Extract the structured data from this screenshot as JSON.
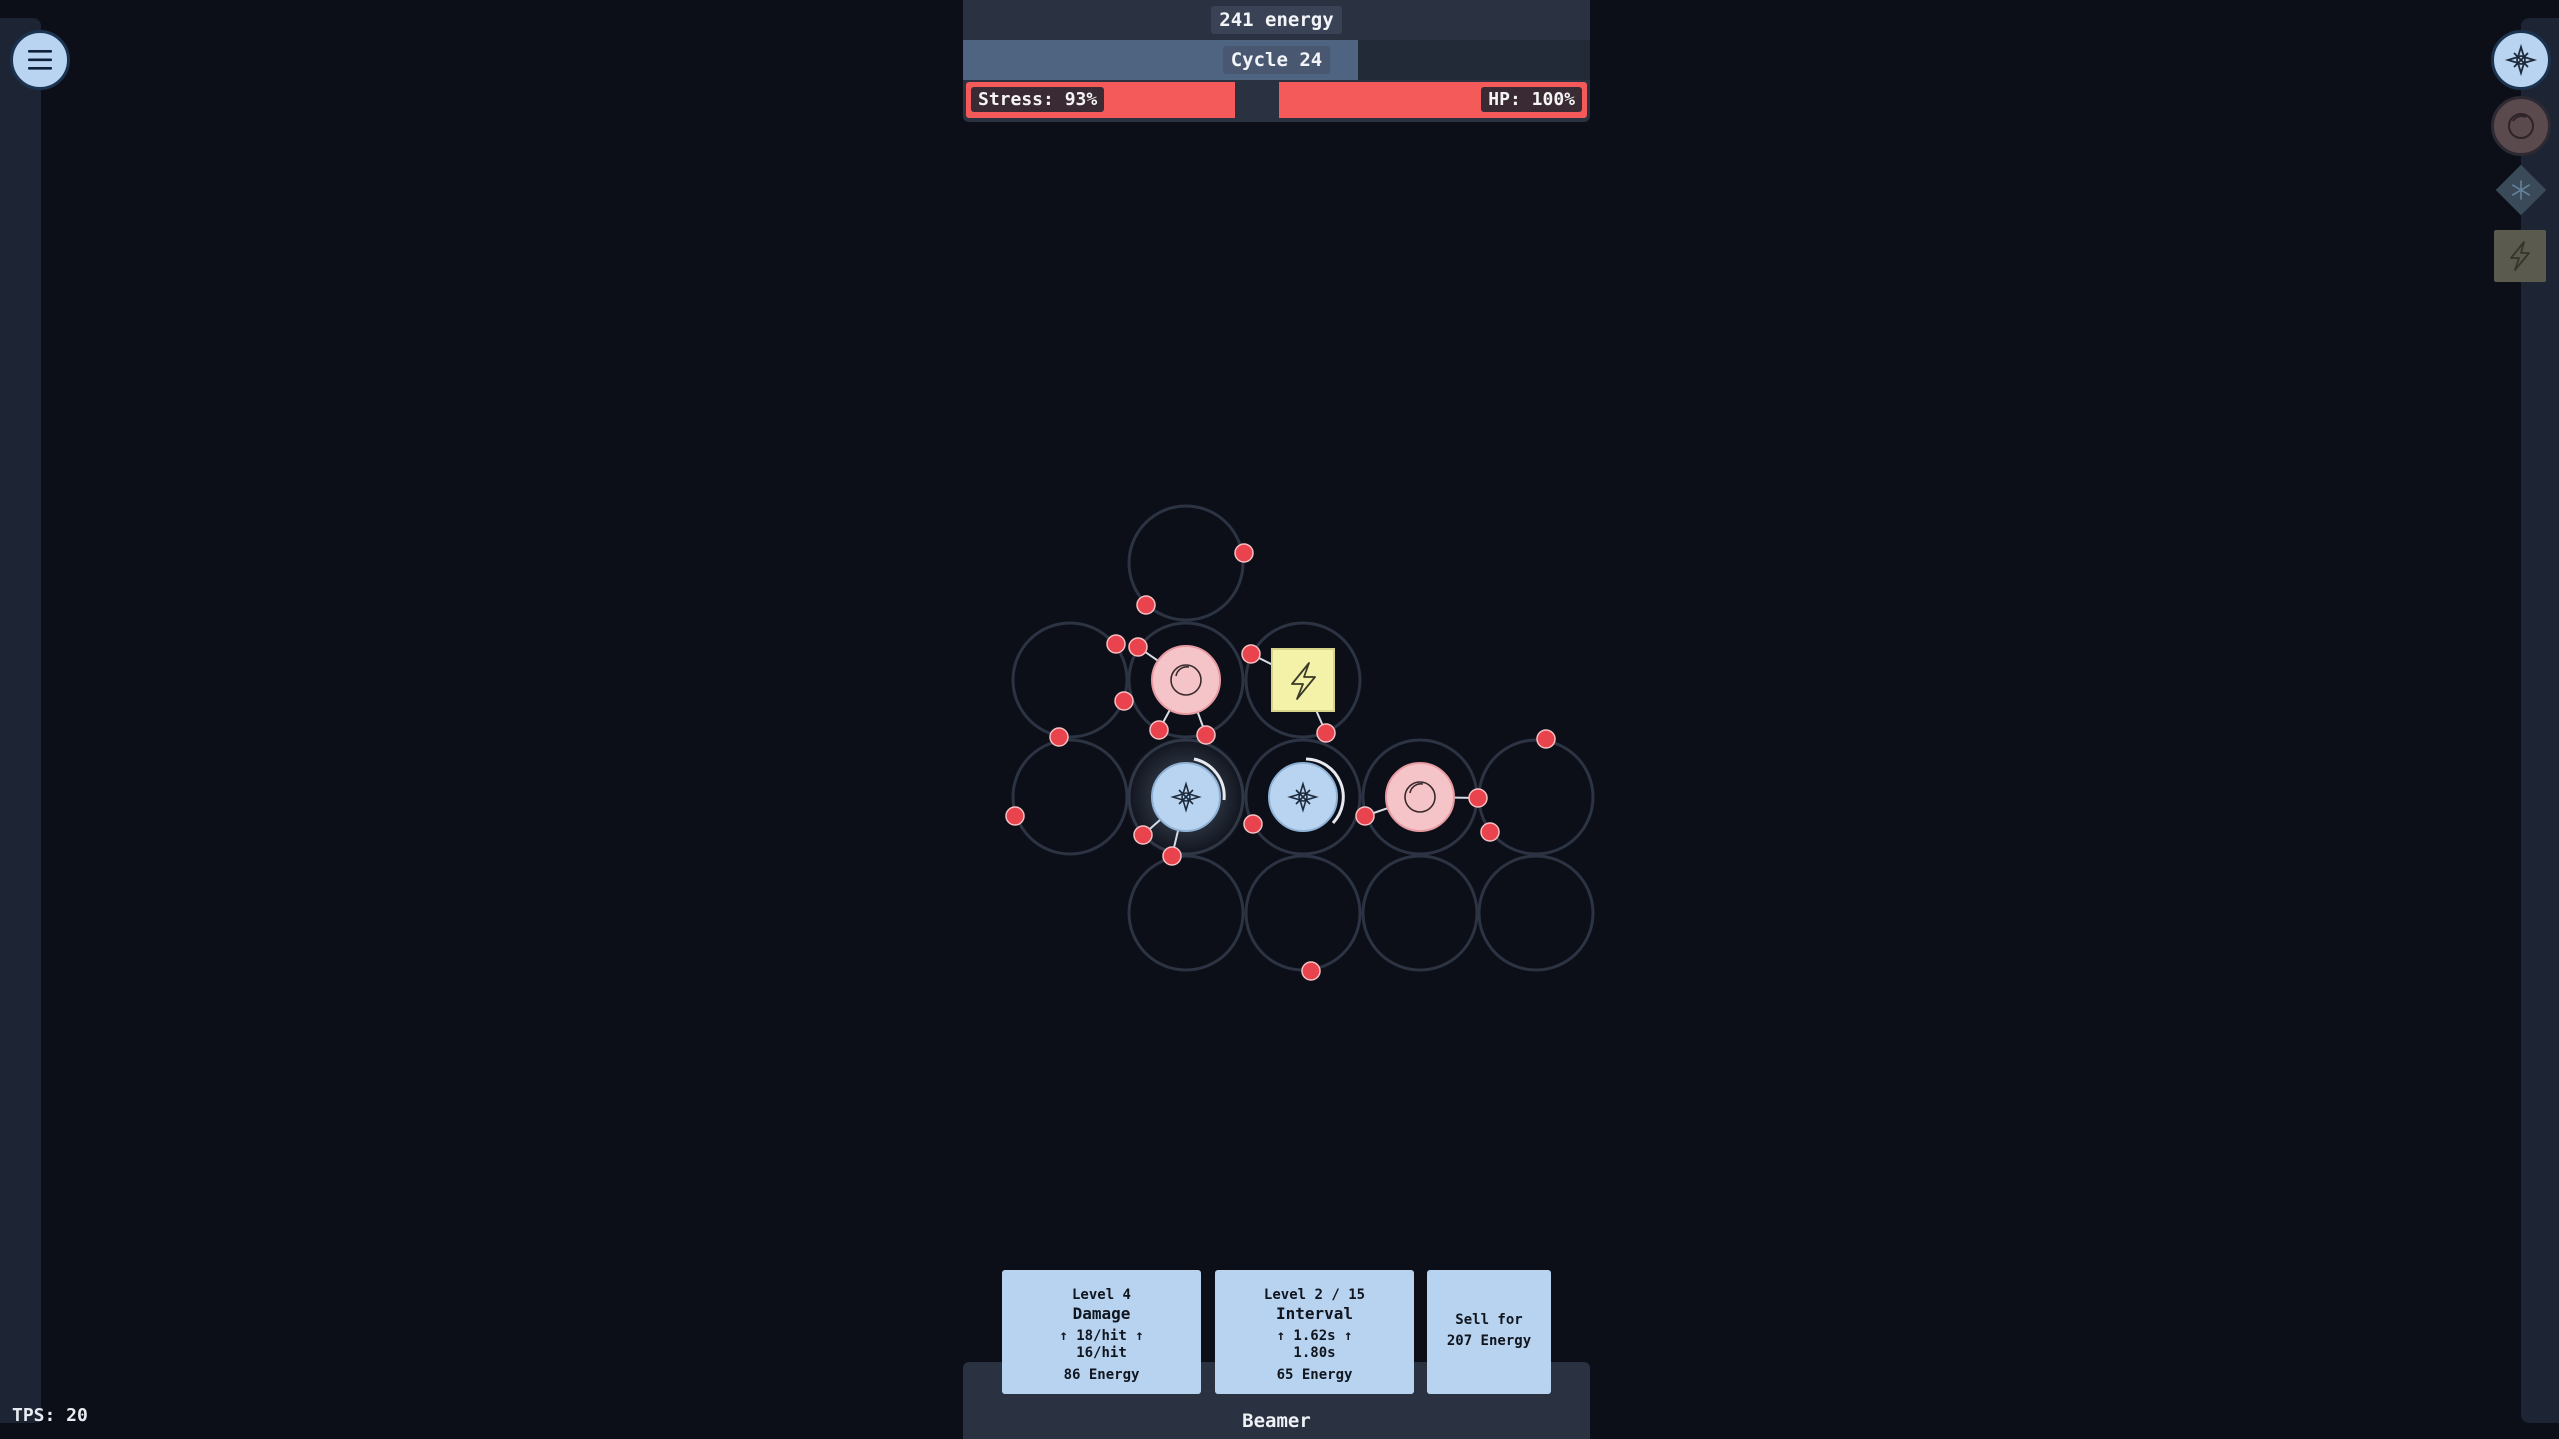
{
  "hud": {
    "energy_label": "241 energy",
    "cycle_label": "Cycle 24",
    "cycle_progress": 0.63,
    "stress_label": "Stress: 93%",
    "stress_fraction": 0.93,
    "hp_label": "HP: 100%",
    "hp_fraction": 1.0
  },
  "palette": {
    "tools": [
      {
        "icon": "beamer-icon",
        "color": "#b9d4f0"
      },
      {
        "icon": "ring-icon",
        "color": "#5a4a4e"
      },
      {
        "icon": "snowflake-icon",
        "color": "#3a4a58"
      },
      {
        "icon": "lightning-icon",
        "color": "#5a5a4e"
      }
    ]
  },
  "selected_unit": {
    "name": "Beamer",
    "upgrades": [
      {
        "level": "Level 4",
        "title": "Damage",
        "line1": "↑ 18/hit ↑",
        "line2": "16/hit",
        "cost": "86 Energy"
      },
      {
        "level": "Level 2 / 15",
        "title": "Interval",
        "line1": "↑ 1.62s ↑",
        "line2": "1.80s",
        "cost": "65 Energy"
      }
    ],
    "sell": {
      "line1": "Sell for",
      "line2": "207 Energy"
    }
  },
  "colors": {
    "beamer": "#b9d4f0",
    "ring": "#f4c4c8",
    "battery": "#f3f2a8",
    "enemy": "#e9434d",
    "cell_outline": "#2c3342"
  },
  "footer": {
    "tps_label": "TPS: 20"
  }
}
